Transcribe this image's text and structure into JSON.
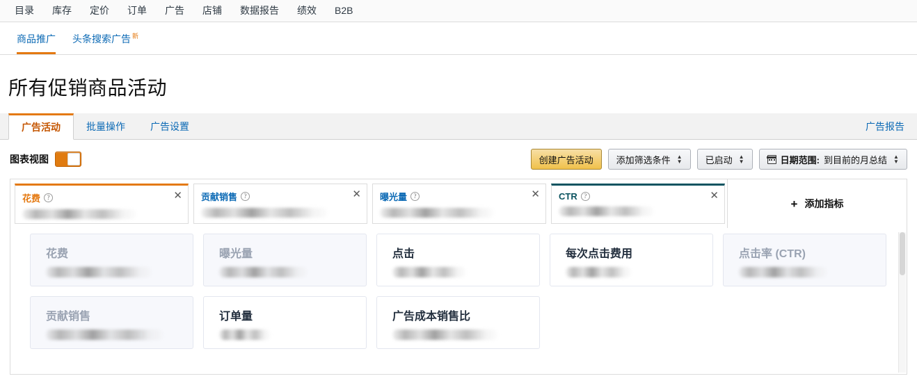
{
  "topnav": {
    "items": [
      {
        "label": "目录"
      },
      {
        "label": "库存"
      },
      {
        "label": "定价"
      },
      {
        "label": "订单"
      },
      {
        "label": "广告"
      },
      {
        "label": "店铺"
      },
      {
        "label": "数据报告"
      },
      {
        "label": "绩效"
      },
      {
        "label": "B2B"
      }
    ]
  },
  "subnav": {
    "items": [
      {
        "label": "商品推广",
        "badge": ""
      },
      {
        "label": "头条搜索广告",
        "badge": "新"
      }
    ]
  },
  "page": {
    "title": "所有促销商品活动"
  },
  "tabs": {
    "items": [
      {
        "label": "广告活动"
      },
      {
        "label": "批量操作"
      },
      {
        "label": "广告设置"
      }
    ],
    "report_link": "广告报告"
  },
  "toolbar": {
    "chart_view_label": "图表视图",
    "chart_view_on": true,
    "create_campaign_label": "创建广告活动",
    "add_filter_label": "添加筛选条件",
    "status_filter_label": "已启动",
    "date_range_prefix": "日期范围:",
    "date_range_value": "到目前的月总结",
    "calendar_icon": "calendar-icon"
  },
  "metrics": {
    "selected": [
      {
        "name": "花费",
        "accent": "orange",
        "help_icon": "help-circle-icon",
        "close_icon": "close-icon"
      },
      {
        "name": "贡献销售",
        "accent": "blue",
        "help_icon": "help-circle-icon",
        "close_icon": "close-icon"
      },
      {
        "name": "曝光量",
        "accent": "blue",
        "help_icon": "help-circle-icon",
        "close_icon": "close-icon"
      },
      {
        "name": "CTR",
        "accent": "teal",
        "help_icon": "help-circle-icon",
        "close_icon": "close-icon"
      }
    ],
    "add_metric_label": "添加指标",
    "add_metric_icon": "plus-icon",
    "picker": {
      "row1": [
        {
          "label": "花费",
          "disabled": true
        },
        {
          "label": "曝光量",
          "disabled": true
        },
        {
          "label": "点击",
          "disabled": false
        },
        {
          "label": "每次点击费用",
          "disabled": false
        },
        {
          "label": "点击率 (CTR)",
          "disabled": true
        }
      ],
      "row2": [
        {
          "label": "贡献销售",
          "disabled": true
        },
        {
          "label": "订单量",
          "disabled": false
        },
        {
          "label": "广告成本销售比",
          "disabled": false
        }
      ]
    }
  },
  "colors": {
    "accent_orange": "#e47911",
    "accent_teal": "#0c5460",
    "link_blue": "#0c6ab5",
    "button_gold": "#f0c14b"
  }
}
